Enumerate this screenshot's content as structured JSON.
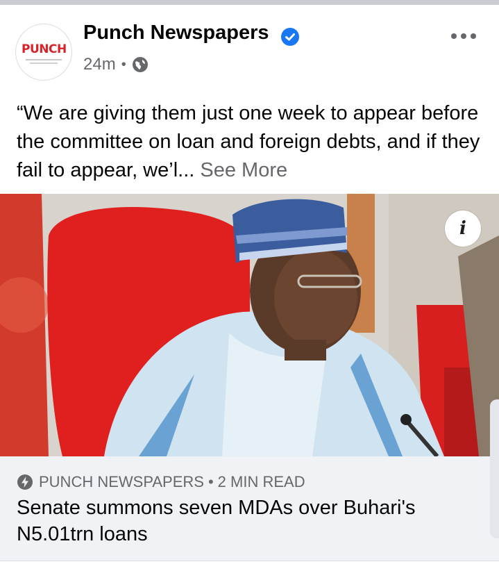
{
  "post": {
    "author": "Punch Newspapers",
    "avatar_text": "PUNCH",
    "time": "24m",
    "separator": "•",
    "text": "“We are giving them just one week to appear before the committee on loan and foreign debts, and if they fail to appear, we’l...",
    "see_more": "See More"
  },
  "icons": {
    "verified": "verified-badge-icon",
    "audience": "globe-icon",
    "menu": "more-options-icon",
    "info": "info-icon",
    "instant": "lightning-icon"
  },
  "link": {
    "source": "PUNCH NEWSPAPERS",
    "separator": "•",
    "read_time": "2 MIN READ",
    "title": "Senate summons seven MDAs over Buhari's N5.01trn loans",
    "info_glyph": "i"
  },
  "colors": {
    "verified_blue": "#1877f2",
    "brand_red": "#d8232a",
    "secondary_text": "#65676b",
    "card_bg": "#f0f2f5"
  }
}
